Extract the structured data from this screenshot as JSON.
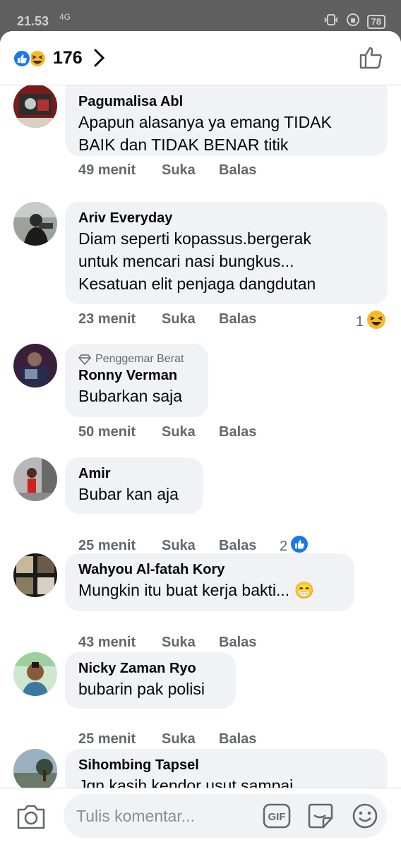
{
  "status_bar": {
    "time": "21.53",
    "network": "4G",
    "battery": "78"
  },
  "header": {
    "reaction_count": "176"
  },
  "comments": [
    {
      "name": "Pagumalisa Abl",
      "badge": "",
      "text": "Apapun alasanya ya emang TIDAK\nBAIK dan TIDAK BENAR titik",
      "time": "49 menit",
      "like": "Suka",
      "reply": "Balas",
      "reaction_count": ""
    },
    {
      "name": "Ariv Everyday",
      "badge": "",
      "text": "Diam seperti kopassus.bergerak\nuntuk mencari nasi bungkus...\nKesatuan elit penjaga dangdutan",
      "time": "23 menit",
      "like": "Suka",
      "reply": "Balas",
      "reaction_count": "1"
    },
    {
      "name": "Ronny Verman",
      "badge": "Penggemar Berat",
      "text": "Bubarkan saja",
      "time": "50 menit",
      "like": "Suka",
      "reply": "Balas",
      "reaction_count": ""
    },
    {
      "name": "Amir",
      "badge": "",
      "text": "Bubar kan aja",
      "time": "25 menit",
      "like": "Suka",
      "reply": "Balas",
      "reaction_count": "2"
    },
    {
      "name": "Wahyou Al-fatah Kory",
      "badge": "",
      "text": "Mungkin itu buat kerja bakti... 😁",
      "time": "43 menit",
      "like": "Suka",
      "reply": "Balas",
      "reaction_count": ""
    },
    {
      "name": "Nicky Zaman Ryo",
      "badge": "",
      "text": "bubarin pak polisi",
      "time": "25 menit",
      "like": "Suka",
      "reply": "Balas",
      "reaction_count": ""
    },
    {
      "name": "Sihombing Tapsel",
      "badge": "",
      "text": "Jgn kasih kendor usut sampai",
      "time": "",
      "like": "",
      "reply": "",
      "reaction_count": ""
    }
  ],
  "composer": {
    "placeholder": "Tulis komentar...",
    "gif_label": "GIF"
  },
  "colors": {
    "like_blue": "#1877f2",
    "haha_yellow": "#f7b928",
    "bubble": "#f0f2f5",
    "meta_gray": "#65676b"
  }
}
